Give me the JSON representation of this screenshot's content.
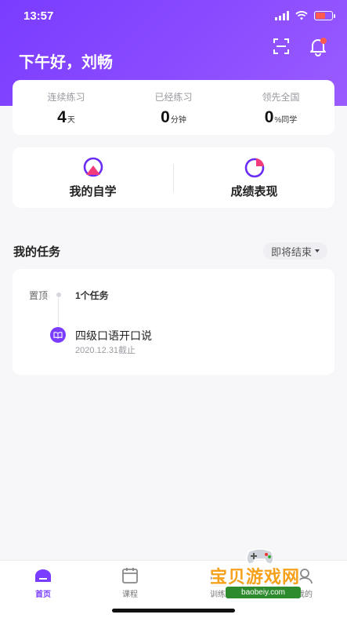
{
  "status_bar": {
    "time": "13:57"
  },
  "header": {
    "greeting": "下午好，刘畅"
  },
  "stats": [
    {
      "label": "连续练习",
      "value": "4",
      "unit": "天"
    },
    {
      "label": "已经练习",
      "value": "0",
      "unit": "分钟"
    },
    {
      "label": "领先全国",
      "value": "0",
      "unit": "%同学"
    }
  ],
  "features": [
    {
      "label": "我的自学",
      "icon": "self-study-icon"
    },
    {
      "label": "成绩表现",
      "icon": "performance-pie-icon"
    }
  ],
  "tasks": {
    "title": "我的任务",
    "filter": "即将结束",
    "pin_label": "置顶",
    "count_label": "1个任务",
    "items": [
      {
        "name": "四级口语开口说",
        "deadline": "2020.12.31截止"
      }
    ]
  },
  "bottom_nav": {
    "items": [
      {
        "label": "首页",
        "icon": "home-icon",
        "active": true
      },
      {
        "label": "课程",
        "icon": "calendar-icon",
        "active": false
      },
      {
        "label": "训练",
        "icon": "training-icon",
        "active": false
      },
      {
        "label": "我的",
        "icon": "profile-icon",
        "active": false
      }
    ]
  },
  "watermark": {
    "text": "宝贝游戏网",
    "url": "baobeiy.com"
  },
  "colors": {
    "accent": "#7a3cff",
    "notification": "#ff5a4f"
  }
}
